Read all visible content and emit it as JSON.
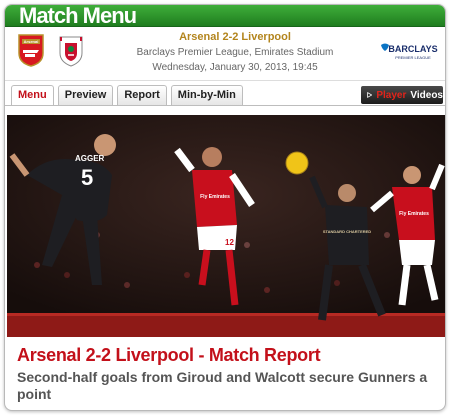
{
  "header": {
    "title": "Match Menu"
  },
  "match": {
    "home_crest": "Arsenal",
    "away_crest": "Liverpool",
    "score_line": "Arsenal 2-2 Liverpool",
    "competition_venue": "Barclays Premier League, Emirates Stadium",
    "datetime": "Wednesday, January 30, 2013, 19:45",
    "sponsor": "BARCLAYS",
    "sponsor_sub": "PREMIER LEAGUE"
  },
  "tabs": [
    {
      "label": "Menu",
      "active": true
    },
    {
      "label": "Preview",
      "active": false
    },
    {
      "label": "Report",
      "active": false
    },
    {
      "label": "Min-by-Min",
      "active": false
    }
  ],
  "videos": {
    "label_red": "Player",
    "label_white": "Videos"
  },
  "photo": {
    "player1_name": "AGGER",
    "player1_number": "5",
    "player2_number": "12",
    "player2_sponsor": "Fly Emirates",
    "player3_sponsor": "Fly Emirates",
    "player4_sponsor": "STANDARD CHARTERED"
  },
  "article": {
    "title": "Arsenal 2-2 Liverpool - Match Report",
    "subtitle": "Second-half goals from Giroud and Walcott secure Gunners a point"
  },
  "colors": {
    "brand_green": "#2e9a2c",
    "accent_red": "#c3101a",
    "score_gold": "#b3851d"
  }
}
